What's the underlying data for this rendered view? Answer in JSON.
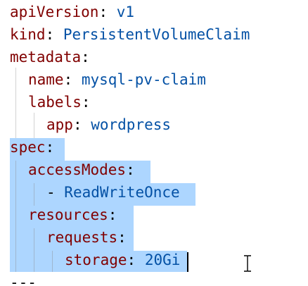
{
  "editor": {
    "lines": [
      {
        "key": "apiVersion",
        "sep": ": ",
        "value": "v1"
      },
      {
        "key": "kind",
        "sep": ": ",
        "value": "PersistentVolumeClaim"
      },
      {
        "key": "metadata",
        "sep": ":",
        "value": ""
      },
      {
        "key": "name",
        "sep": ": ",
        "value": "mysql-pv-claim"
      },
      {
        "key": "labels",
        "sep": ":",
        "value": ""
      },
      {
        "key": "app",
        "sep": ": ",
        "value": "wordpress"
      },
      {
        "key": "spec",
        "sep": ":",
        "value": ""
      },
      {
        "key": "accessModes",
        "sep": ":",
        "value": ""
      },
      {
        "dash": "- ",
        "value": "ReadWriteOnce"
      },
      {
        "key": "resources",
        "sep": ":",
        "value": ""
      },
      {
        "key": "requests",
        "sep": ":",
        "value": ""
      },
      {
        "key": "storage",
        "sep": ": ",
        "value": "20Gi"
      },
      {
        "plain": "---"
      }
    ],
    "colors": {
      "key": "#800000",
      "value": "#0451a5",
      "selection": "#add6ff",
      "indent_guide": "#d3d3d3"
    }
  }
}
